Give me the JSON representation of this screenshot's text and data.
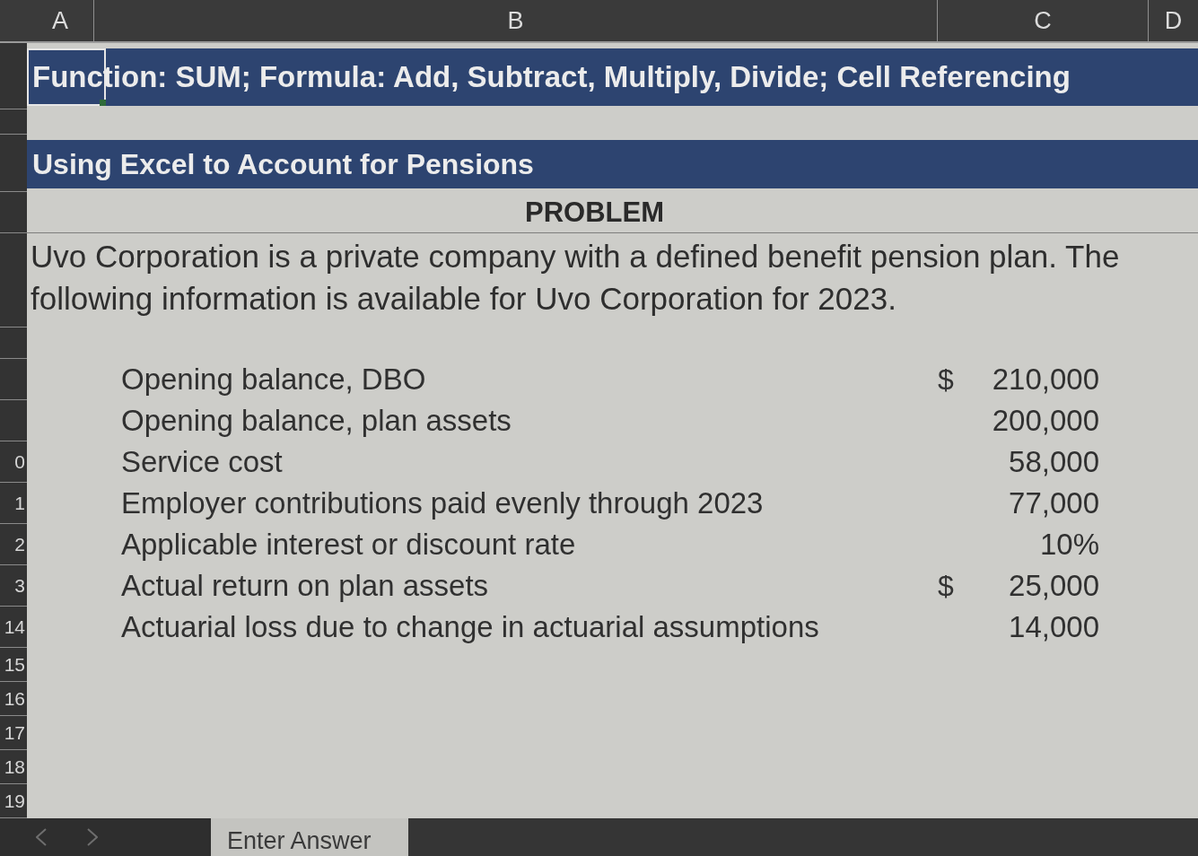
{
  "sheet": {
    "columns": [
      {
        "label": "A"
      },
      {
        "label": "B"
      },
      {
        "label": "C"
      },
      {
        "label": "D"
      }
    ],
    "banner": {
      "text": "Function: SUM; Formula: Add, Subtract, Multiply, Divide; Cell Referencing",
      "selected": true
    },
    "section_title": "Using Excel to Account for Pensions",
    "problem_heading": "PROBLEM",
    "problem_text": "Uvo Corporation is a private company with a defined benefit pension plan. The following information is available for Uvo Corporation for 2023.",
    "items": [
      {
        "label": "Opening balance, DBO",
        "currency": "$",
        "value": "210,000"
      },
      {
        "label": "Opening balance, plan assets",
        "value": "200,000"
      },
      {
        "label": "Service cost",
        "value": "58,000",
        "row_number": "0"
      },
      {
        "label": "Employer contributions paid evenly through 2023",
        "value": "77,000",
        "row_number": "1"
      },
      {
        "label": "Applicable interest or discount rate",
        "value": "10%",
        "row_number": "2"
      },
      {
        "label": "Actual return on plan assets",
        "currency": "$",
        "value": "25,000",
        "row_number": "3"
      },
      {
        "label": "Actuarial loss due to change in actuarial assumptions",
        "value": "14,000",
        "row_number": "14"
      }
    ],
    "empty_rows": [
      {
        "row_number": "15"
      },
      {
        "row_number": "16"
      },
      {
        "row_number": "17"
      },
      {
        "row_number": "18"
      },
      {
        "row_number": "19"
      }
    ]
  },
  "sheet_tabs": [
    {
      "label": "Enter Answer",
      "selected": true
    }
  ]
}
